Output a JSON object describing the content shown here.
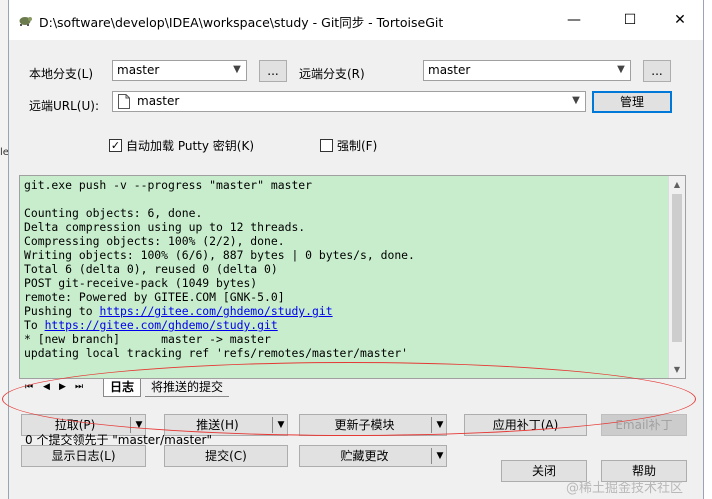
{
  "window": {
    "title": "D:\\software\\develop\\IDEA\\workspace\\study - Git同步 - TortoiseGit",
    "min_glyph": "—",
    "max_glyph": "☐",
    "close_glyph": "✕"
  },
  "local_branch": {
    "label": "本地分支(L)",
    "value": "master",
    "browse_label": "..."
  },
  "remote_branch": {
    "label": "远端分支(R)",
    "value": "master",
    "browse_label": "..."
  },
  "remote_url": {
    "label": "远端URL(U):",
    "value": "master",
    "manage_label": "管理"
  },
  "options": {
    "autoload_putty": {
      "label": "自动加载 Putty 密钥(K)",
      "checked": true,
      "check_glyph": "✓"
    },
    "force": {
      "label": "强制(F)",
      "checked": false
    }
  },
  "log": {
    "lines": [
      "git.exe push -v --progress \"master\" master",
      "",
      "Counting objects: 6, done.",
      "Delta compression using up to 12 threads.",
      "Compressing objects: 100% (2/2), done.",
      "Writing objects: 100% (6/6), 887 bytes | 0 bytes/s, done.",
      "Total 6 (delta 0), reused 0 (delta 0)",
      "POST git-receive-pack (1049 bytes)",
      "remote: Powered by GITEE.COM [GNK-5.0]"
    ],
    "pushing_prefix": "Pushing to ",
    "url": "https://gitee.com/ghdemo/study.git",
    "to_prefix": "To ",
    "tail_lines": [
      "* [new branch]      master -> master",
      "updating local tracking ref 'refs/remotes/master/master'"
    ]
  },
  "tabs": {
    "nav": [
      "⏮",
      "◀",
      "▶",
      "⏭"
    ],
    "active": "日志",
    "other": "将推送的提交"
  },
  "actions": {
    "pull": "拉取(P)",
    "push": "推送(H)",
    "update_submodules": "更新子模块",
    "apply_patch": "应用补丁(A)",
    "email_patch": "Email补丁",
    "show_log": "显示日志(L)",
    "commit": "提交(C)",
    "stash": "贮藏更改",
    "close": "关闭",
    "help": "帮助",
    "dropdown_glyph": "▼"
  },
  "status_text": "0 个提交领先于 \"master/master\"",
  "watermark": "@稀土掘金技术社区",
  "side_mark": "le"
}
